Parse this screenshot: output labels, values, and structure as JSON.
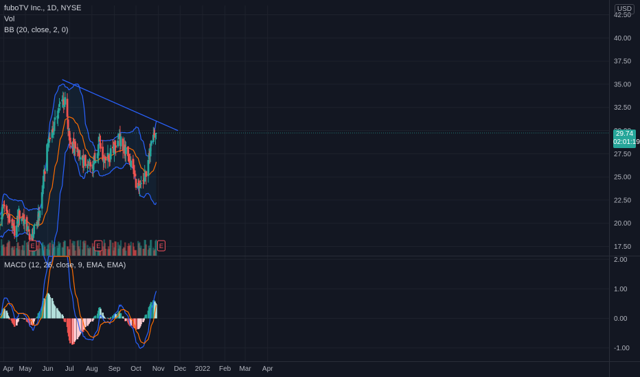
{
  "header": {
    "title": "fuboTV Inc., 1D, NYSE",
    "vol_label": "Vol",
    "bb_label": "BB (20, close, 2, 0)",
    "currency": "USD"
  },
  "last_price": {
    "value": "29.74",
    "countdown": "02:01:19"
  },
  "macd_label": "MACD (12, 26, close, 9, EMA, EMA)",
  "earnings_marker": "E",
  "colors": {
    "up": "#26a69a",
    "down": "#ef5350",
    "bb": "#2962ff",
    "basis": "#ff6d00",
    "trendline": "#2962ff",
    "background": "#131722"
  },
  "chart_data": {
    "type": "candlestick",
    "price_axis": {
      "ticks": [
        "42.50",
        "40.00",
        "37.50",
        "35.00",
        "32.50",
        "30.00",
        "27.50",
        "25.00",
        "22.50",
        "20.00",
        "17.50"
      ],
      "range": [
        16.5,
        43.5
      ]
    },
    "macd_axis": {
      "ticks": [
        "2.00",
        "1.00",
        "0.00",
        "-1.00"
      ],
      "range": [
        -1.45,
        2.1
      ]
    },
    "time_axis": {
      "labels": [
        "Apr",
        "May",
        "Jun",
        "Jul",
        "Aug",
        "Sep",
        "Oct",
        "Nov",
        "Dec",
        "2022",
        "Feb",
        "Mar",
        "Apr"
      ]
    },
    "keypoints": [
      [
        "2021-03-25",
        19.5
      ],
      [
        "2021-04-01",
        22.0
      ],
      [
        "2021-04-08",
        20.5
      ],
      [
        "2021-04-15",
        19.0
      ],
      [
        "2021-04-22",
        21.0
      ],
      [
        "2021-04-29",
        20.5
      ],
      [
        "2021-05-05",
        19.0
      ],
      [
        "2021-05-10",
        18.5
      ],
      [
        "2021-05-14",
        19.3
      ],
      [
        "2021-05-20",
        21.0
      ],
      [
        "2021-05-26",
        24.5
      ],
      [
        "2021-06-01",
        28.5
      ],
      [
        "2021-06-08",
        30.0
      ],
      [
        "2021-06-14",
        31.5
      ],
      [
        "2021-06-20",
        33.5
      ],
      [
        "2021-06-25",
        33.0
      ],
      [
        "2021-07-01",
        29.0
      ],
      [
        "2021-07-08",
        28.0
      ],
      [
        "2021-07-15",
        27.0
      ],
      [
        "2021-07-22",
        26.5
      ],
      [
        "2021-07-30",
        26.0
      ],
      [
        "2021-08-09",
        27.5
      ],
      [
        "2021-08-11",
        29.5
      ],
      [
        "2021-08-17",
        27.0
      ],
      [
        "2021-08-25",
        27.0
      ],
      [
        "2021-09-01",
        28.5
      ],
      [
        "2021-09-08",
        29.0
      ],
      [
        "2021-09-15",
        28.0
      ],
      [
        "2021-09-22",
        27.0
      ],
      [
        "2021-09-29",
        25.0
      ],
      [
        "2021-10-05",
        23.5
      ],
      [
        "2021-10-12",
        24.5
      ],
      [
        "2021-10-19",
        27.0
      ],
      [
        "2021-10-22",
        29.5
      ],
      [
        "2021-10-27",
        29.5
      ],
      [
        "2021-10-29",
        29.74
      ]
    ],
    "bollinger": {
      "period": 20,
      "stdev": 2
    },
    "macd": {
      "fast": 12,
      "slow": 26,
      "signal": 9
    },
    "trendline": {
      "from": [
        "2021-06-21",
        35.5
      ],
      "to": [
        "2021-11-28",
        30.0
      ]
    },
    "earnings_dates": [
      "2021-05-11",
      "2021-08-10",
      "2021-11-05"
    ],
    "last_date": "2021-10-29"
  }
}
